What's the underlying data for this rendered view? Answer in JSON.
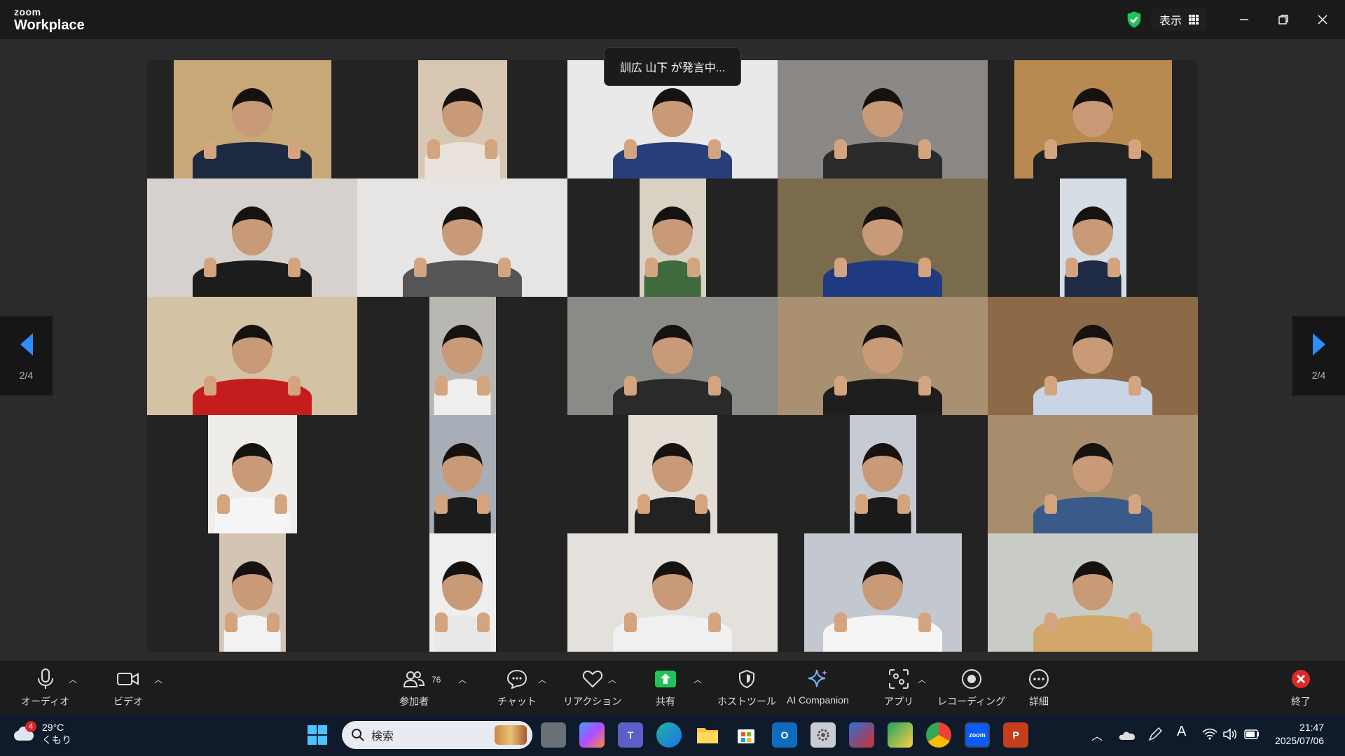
{
  "app": {
    "brand_small": "zoom",
    "brand_big": "Workplace",
    "view_label": "表示"
  },
  "speaking": "訓広 山下 が発言中...",
  "pager": {
    "left": "2/4",
    "right": "2/4"
  },
  "toolbar": {
    "audio": "オーディオ",
    "video": "ビデオ",
    "participants": "参加者",
    "participants_count": "76",
    "chat": "チャット",
    "reactions": "リアクション",
    "share": "共有",
    "host_tools": "ホストツール",
    "ai_companion": "AI Companion",
    "apps": "アプリ",
    "recording": "レコーディング",
    "more": "詳細",
    "end": "終了"
  },
  "taskbar": {
    "weather_temp": "29°C",
    "weather_desc": "くもり",
    "weather_badge": "4",
    "search_placeholder": "検索",
    "time": "21:47",
    "date": "2025/07/06"
  },
  "colors": {
    "accent": "#0b5cff",
    "share_green": "#1fc35a",
    "end_red": "#e02828"
  }
}
